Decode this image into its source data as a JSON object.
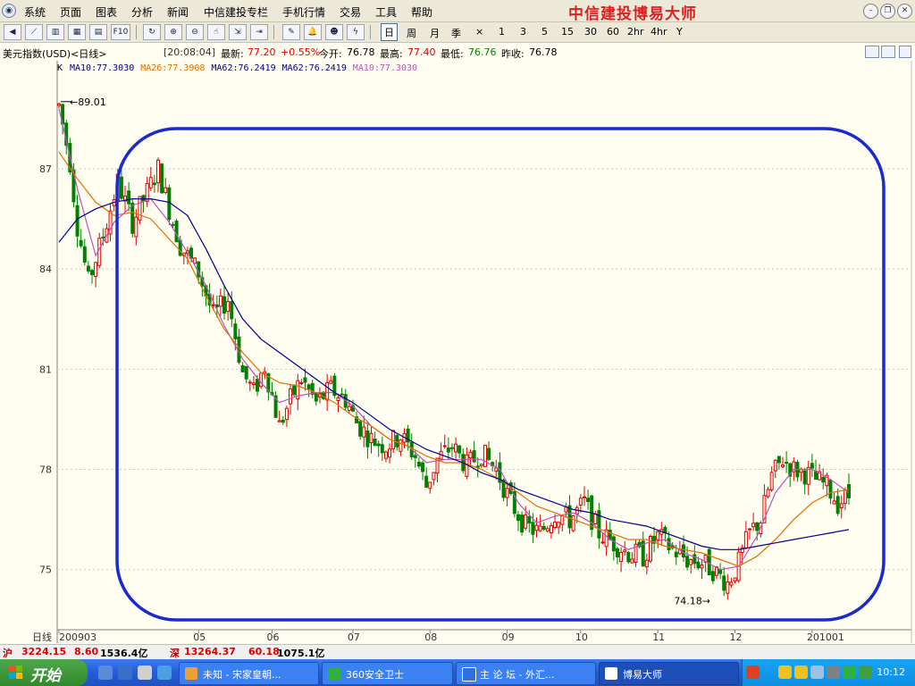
{
  "menu": {
    "items": [
      "系统",
      "页面",
      "图表",
      "分析",
      "新闻",
      "中信建投专栏",
      "手机行情",
      "交易",
      "工具",
      "帮助"
    ],
    "brand": "中信建投博易大师"
  },
  "toolbar": {
    "periods": [
      "日",
      "周",
      "月",
      "季",
      "×",
      "1",
      "3",
      "5",
      "15",
      "30",
      "60",
      "2hr",
      "4hr",
      "Y"
    ],
    "active_period": "日"
  },
  "info": {
    "symbol": "美元指数(USD)<日线>",
    "time": "[20:08:04]",
    "last_label": "最新:",
    "last": "77.20",
    "change": "+0.55%",
    "open_label": "今开:",
    "open": "76.78",
    "high_label": "最高:",
    "high": "77.40",
    "low_label": "最低:",
    "low": "76.76",
    "prev_label": "昨收:",
    "prev": "76.78",
    "ma_prefix": "K",
    "ma": [
      {
        "label": "MA10:77.3030",
        "color": "#000080"
      },
      {
        "label": "MA26:77.3908",
        "color": "#e07000"
      },
      {
        "label": "MA62:76.2419",
        "color": "#000080"
      },
      {
        "label": "MA62:76.2419",
        "color": "#000080"
      },
      {
        "label": "MA10:77.3030",
        "color": "#c050c0"
      }
    ]
  },
  "chart_data": {
    "type": "candlestick",
    "period_label": "日线",
    "y_ticks": [
      75,
      78,
      81,
      84,
      87
    ],
    "ylim": [
      73.2,
      89.7
    ],
    "x_ticks": [
      {
        "label": "200903",
        "x": 0
      },
      {
        "label": "05",
        "x": 38
      },
      {
        "label": "06",
        "x": 58
      },
      {
        "label": "07",
        "x": 80
      },
      {
        "label": "08",
        "x": 101
      },
      {
        "label": "09",
        "x": 122
      },
      {
        "label": "10",
        "x": 142
      },
      {
        "label": "11",
        "x": 163
      },
      {
        "label": "12",
        "x": 184
      },
      {
        "label": "201001",
        "x": 205
      }
    ],
    "x_range": [
      0,
      215
    ],
    "high_annotation": {
      "label": "89.01",
      "x": 0,
      "value": 89.01
    },
    "low_annotation": {
      "label": "74.18",
      "x": 182,
      "value": 74.18
    },
    "close_path": [
      [
        0,
        88.9
      ],
      [
        3,
        87.2
      ],
      [
        5,
        85.3
      ],
      [
        8,
        83.6
      ],
      [
        12,
        85.0
      ],
      [
        16,
        86.6
      ],
      [
        20,
        85.4
      ],
      [
        24,
        86.3
      ],
      [
        27,
        87.0
      ],
      [
        30,
        85.8
      ],
      [
        33,
        84.7
      ],
      [
        38,
        83.9
      ],
      [
        42,
        82.6
      ],
      [
        46,
        83.1
      ],
      [
        50,
        80.9
      ],
      [
        53,
        80.3
      ],
      [
        56,
        81.1
      ],
      [
        60,
        79.3
      ],
      [
        63,
        80.1
      ],
      [
        66,
        80.7
      ],
      [
        70,
        80.0
      ],
      [
        74,
        80.4
      ],
      [
        78,
        80.1
      ],
      [
        81,
        79.4
      ],
      [
        85,
        78.9
      ],
      [
        89,
        78.7
      ],
      [
        93,
        79.0
      ],
      [
        97,
        78.4
      ],
      [
        100,
        77.5
      ],
      [
        103,
        78.3
      ],
      [
        107,
        78.7
      ],
      [
        111,
        78.1
      ],
      [
        115,
        78.5
      ],
      [
        119,
        78.0
      ],
      [
        123,
        77.0
      ],
      [
        127,
        76.3
      ],
      [
        131,
        76.1
      ],
      [
        135,
        76.7
      ],
      [
        139,
        76.5
      ],
      [
        143,
        77.0
      ],
      [
        147,
        76.1
      ],
      [
        151,
        75.8
      ],
      [
        155,
        75.5
      ],
      [
        159,
        75.4
      ],
      [
        163,
        76.0
      ],
      [
        167,
        75.6
      ],
      [
        171,
        75.3
      ],
      [
        175,
        75.2
      ],
      [
        178,
        75.0
      ],
      [
        182,
        74.6
      ],
      [
        185,
        75.2
      ],
      [
        188,
        76.1
      ],
      [
        191,
        76.5
      ],
      [
        194,
        77.8
      ],
      [
        197,
        78.3
      ],
      [
        200,
        78.0
      ],
      [
        203,
        77.9
      ],
      [
        206,
        77.7
      ],
      [
        209,
        77.5
      ],
      [
        212,
        77.0
      ],
      [
        215,
        77.2
      ]
    ],
    "series": [
      {
        "name": "MA10",
        "color": "#c050c0",
        "values": [
          [
            0,
            88.8
          ],
          [
            5,
            86.4
          ],
          [
            10,
            84.4
          ],
          [
            15,
            85.4
          ],
          [
            20,
            85.9
          ],
          [
            25,
            86.1
          ],
          [
            30,
            85.4
          ],
          [
            36,
            84.3
          ],
          [
            40,
            83.5
          ],
          [
            45,
            82.3
          ],
          [
            50,
            81.3
          ],
          [
            55,
            80.6
          ],
          [
            60,
            80.0
          ],
          [
            65,
            80.2
          ],
          [
            70,
            80.3
          ],
          [
            75,
            80.3
          ],
          [
            80,
            79.9
          ],
          [
            85,
            79.3
          ],
          [
            90,
            78.9
          ],
          [
            95,
            78.7
          ],
          [
            100,
            78.2
          ],
          [
            105,
            78.3
          ],
          [
            110,
            78.3
          ],
          [
            115,
            78.3
          ],
          [
            120,
            78.0
          ],
          [
            125,
            77.0
          ],
          [
            130,
            76.4
          ],
          [
            135,
            76.6
          ],
          [
            140,
            76.7
          ],
          [
            145,
            76.4
          ],
          [
            150,
            75.9
          ],
          [
            155,
            75.6
          ],
          [
            160,
            75.8
          ],
          [
            165,
            75.9
          ],
          [
            170,
            75.5
          ],
          [
            175,
            75.3
          ],
          [
            180,
            75.0
          ],
          [
            185,
            75.1
          ],
          [
            190,
            76.0
          ],
          [
            195,
            77.3
          ],
          [
            200,
            78.0
          ],
          [
            205,
            78.0
          ],
          [
            210,
            77.7
          ],
          [
            215,
            77.3
          ]
        ]
      },
      {
        "name": "MA26",
        "color": "#e07000",
        "values": [
          [
            0,
            87.5
          ],
          [
            5,
            86.7
          ],
          [
            10,
            86.0
          ],
          [
            15,
            85.6
          ],
          [
            20,
            85.7
          ],
          [
            25,
            85.5
          ],
          [
            30,
            84.9
          ],
          [
            35,
            84.3
          ],
          [
            40,
            83.2
          ],
          [
            45,
            82.2
          ],
          [
            50,
            81.5
          ],
          [
            55,
            80.9
          ],
          [
            60,
            80.6
          ],
          [
            65,
            80.5
          ],
          [
            70,
            80.3
          ],
          [
            75,
            80.0
          ],
          [
            80,
            79.6
          ],
          [
            85,
            79.3
          ],
          [
            90,
            78.9
          ],
          [
            95,
            78.7
          ],
          [
            100,
            78.4
          ],
          [
            105,
            78.2
          ],
          [
            110,
            78.2
          ],
          [
            115,
            78.0
          ],
          [
            120,
            77.7
          ],
          [
            125,
            77.3
          ],
          [
            130,
            76.9
          ],
          [
            135,
            76.7
          ],
          [
            140,
            76.5
          ],
          [
            145,
            76.3
          ],
          [
            150,
            76.1
          ],
          [
            155,
            75.9
          ],
          [
            160,
            75.9
          ],
          [
            165,
            75.7
          ],
          [
            170,
            75.6
          ],
          [
            175,
            75.5
          ],
          [
            180,
            75.3
          ],
          [
            185,
            75.1
          ],
          [
            190,
            75.4
          ],
          [
            195,
            75.9
          ],
          [
            200,
            76.5
          ],
          [
            205,
            77.0
          ],
          [
            210,
            77.3
          ],
          [
            215,
            77.4
          ]
        ]
      },
      {
        "name": "MA62",
        "color": "#000090",
        "values": [
          [
            0,
            84.8
          ],
          [
            5,
            85.5
          ],
          [
            10,
            85.8
          ],
          [
            15,
            86.0
          ],
          [
            20,
            86.1
          ],
          [
            25,
            86.1
          ],
          [
            30,
            86.0
          ],
          [
            35,
            85.6
          ],
          [
            40,
            84.6
          ],
          [
            45,
            83.5
          ],
          [
            50,
            82.5
          ],
          [
            55,
            81.9
          ],
          [
            60,
            81.5
          ],
          [
            65,
            81.1
          ],
          [
            70,
            80.7
          ],
          [
            75,
            80.3
          ],
          [
            80,
            80.0
          ],
          [
            85,
            79.6
          ],
          [
            90,
            79.2
          ],
          [
            95,
            78.9
          ],
          [
            100,
            78.6
          ],
          [
            105,
            78.4
          ],
          [
            110,
            78.2
          ],
          [
            115,
            77.9
          ],
          [
            120,
            77.7
          ],
          [
            125,
            77.4
          ],
          [
            130,
            77.2
          ],
          [
            135,
            77.0
          ],
          [
            140,
            76.8
          ],
          [
            145,
            76.7
          ],
          [
            150,
            76.5
          ],
          [
            155,
            76.4
          ],
          [
            160,
            76.3
          ],
          [
            165,
            76.1
          ],
          [
            170,
            75.9
          ],
          [
            175,
            75.7
          ],
          [
            180,
            75.6
          ],
          [
            185,
            75.6
          ],
          [
            190,
            75.7
          ],
          [
            195,
            75.8
          ],
          [
            200,
            75.9
          ],
          [
            205,
            76.0
          ],
          [
            210,
            76.1
          ],
          [
            215,
            76.2
          ]
        ]
      }
    ]
  },
  "quote_bar": {
    "sh_label": "沪",
    "sh_index": "3224.15",
    "sh_change": "8.60",
    "sh_amount": "1536.4亿",
    "sz_label": "深",
    "sz_index": "13264.37",
    "sz_change": "60.18",
    "sz_amount": "1075.1亿"
  },
  "taskbar": {
    "start": "开始",
    "tasks": [
      {
        "label": "未知 - 宋家皇朝...",
        "color": "#f0a030"
      },
      {
        "label": "360安全卫士",
        "color": "#30b040"
      },
      {
        "label": "主 论 坛 - 外汇...",
        "color": "#3070e0"
      },
      {
        "label": "博易大师",
        "color": "#ffffff"
      }
    ],
    "clock": "10:12"
  }
}
